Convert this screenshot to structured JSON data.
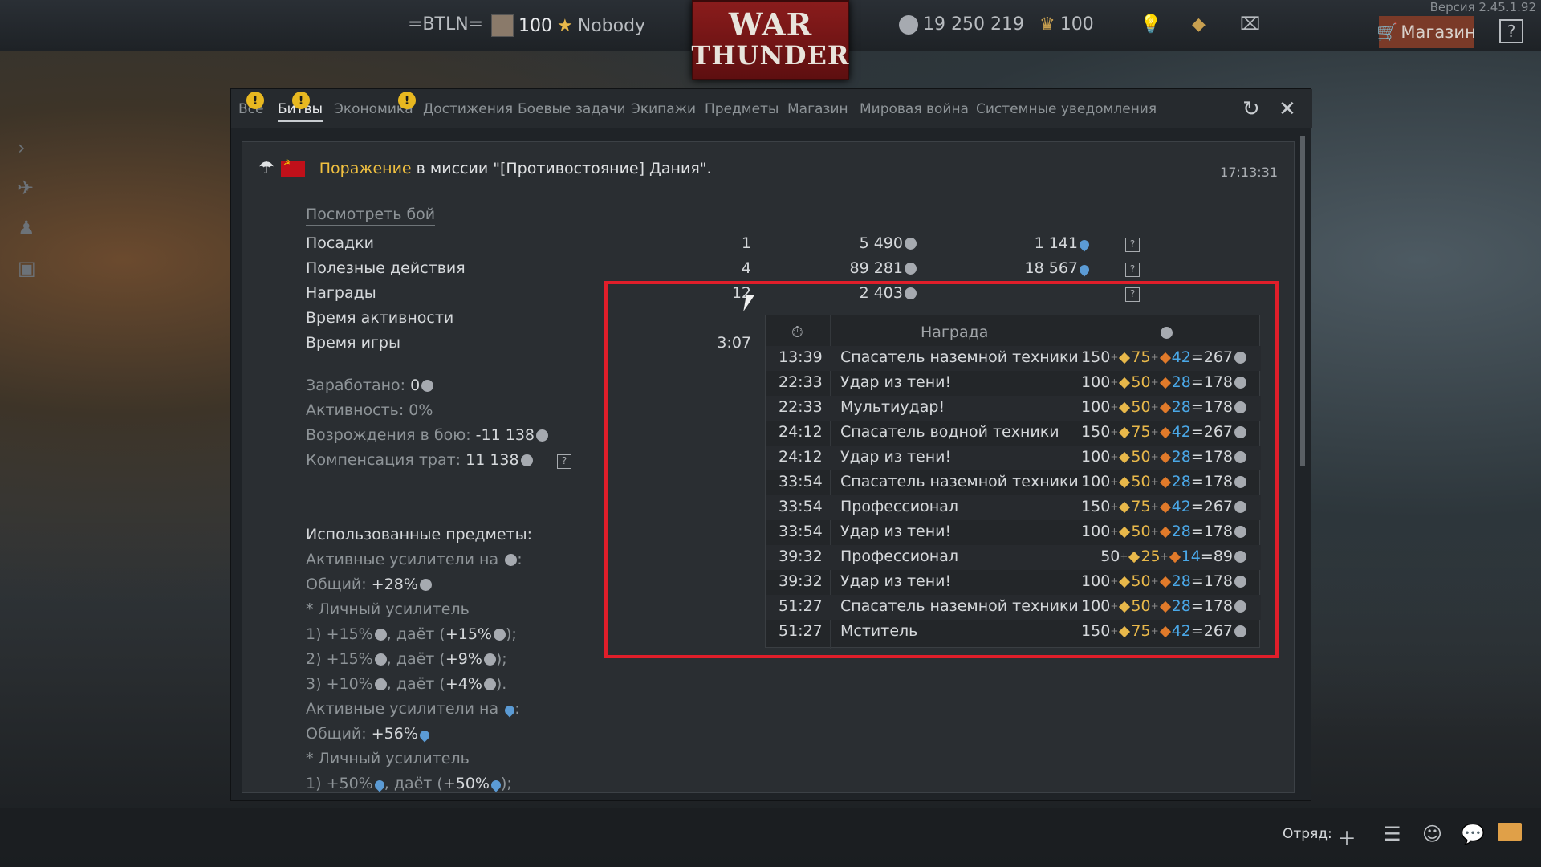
{
  "version": "Версия 2.45.1.92",
  "topbar": {
    "clan_tag": "=BTLN=",
    "level": "100",
    "nickname": "Nobody",
    "logo_line1": "WAR",
    "logo_line2": "THUNDER",
    "silver_lions": "19 250 219",
    "golden_eagles": "100",
    "shop_label": "Магазин",
    "help_label": "?"
  },
  "tabs": [
    {
      "label": "Все",
      "warn": true
    },
    {
      "label": "Битвы",
      "warn": true,
      "active": true
    },
    {
      "label": "Экономика",
      "warn": true
    },
    {
      "label": "Достижения"
    },
    {
      "label": "Боевые задачи"
    },
    {
      "label": "Экипажи"
    },
    {
      "label": "Предметы"
    },
    {
      "label": "Магазин"
    },
    {
      "label": "Мировая война"
    },
    {
      "label": "Системные уведомления"
    }
  ],
  "message": {
    "result": "Поражение",
    "text": "в миссии \"[Противостояние] Дания\".",
    "time": "17:13:31",
    "view_battle": "Посмотреть бой"
  },
  "stats": [
    {
      "label": "Посадки",
      "count": "1",
      "sl": "5 490",
      "rp": "1 141"
    },
    {
      "label": "Полезные действия",
      "count": "4",
      "sl": "89 281",
      "rp": "18 567"
    },
    {
      "label": "Награды",
      "count": "12",
      "sl": "2 403",
      "rp": ""
    },
    {
      "label": "Время активности",
      "count": "",
      "sl": "",
      "rp": ""
    },
    {
      "label": "Время игры",
      "count": "3:07",
      "sl": "",
      "rp": ""
    }
  ],
  "summary": {
    "earned_label": "Заработано:",
    "earned_value": "0",
    "activity": "Активность: 0%",
    "respawns_label": "Возрождения в бою:",
    "respawns_value": "-11 138",
    "compensation_label": "Компенсация трат:",
    "compensation_value": "11 138"
  },
  "boosters": {
    "title": "Использованные предметы:",
    "sl_active": "Активные усилители на",
    "sl_total_label": "Общий:",
    "sl_total": "+28%",
    "personal": "* Личный усилитель",
    "sl_items": [
      {
        "n": "1)",
        "pct": "+15%",
        "gives": "+15%"
      },
      {
        "n": "2)",
        "pct": "+15%",
        "gives": "+9%"
      },
      {
        "n": "3)",
        "pct": "+10%",
        "gives": "+4%"
      }
    ],
    "gives_label": "даёт",
    "rp_active": "Активные усилители на",
    "rp_total_label": "Общий:",
    "rp_total": "+56%",
    "rp_personal": "* Личный усилитель",
    "rp_items": [
      {
        "n": "1)",
        "pct": "+50%",
        "gives": "+50%"
      }
    ]
  },
  "tooltip": {
    "header_reward": "Награда",
    "rows": [
      {
        "time": "13:39",
        "name": "Спасатель наземной техники",
        "base": "150",
        "b1": "75",
        "b2": "42",
        "total": "267"
      },
      {
        "time": "22:33",
        "name": "Удар из тени!",
        "base": "100",
        "b1": "50",
        "b2": "28",
        "total": "178"
      },
      {
        "time": "22:33",
        "name": "Мультиудар!",
        "base": "100",
        "b1": "50",
        "b2": "28",
        "total": "178"
      },
      {
        "time": "24:12",
        "name": "Спасатель водной техники",
        "base": "150",
        "b1": "75",
        "b2": "42",
        "total": "267"
      },
      {
        "time": "24:12",
        "name": "Удар из тени!",
        "base": "100",
        "b1": "50",
        "b2": "28",
        "total": "178"
      },
      {
        "time": "33:54",
        "name": "Спасатель наземной техники",
        "base": "100",
        "b1": "50",
        "b2": "28",
        "total": "178"
      },
      {
        "time": "33:54",
        "name": "Профессионал",
        "base": "150",
        "b1": "75",
        "b2": "42",
        "total": "267"
      },
      {
        "time": "33:54",
        "name": "Удар из тени!",
        "base": "100",
        "b1": "50",
        "b2": "28",
        "total": "178"
      },
      {
        "time": "39:32",
        "name": "Профессионал",
        "base": "50",
        "b1": "25",
        "b2": "14",
        "total": "89"
      },
      {
        "time": "39:32",
        "name": "Удар из тени!",
        "base": "100",
        "b1": "50",
        "b2": "28",
        "total": "178"
      },
      {
        "time": "51:27",
        "name": "Спасатель наземной техники",
        "base": "100",
        "b1": "50",
        "b2": "28",
        "total": "178"
      },
      {
        "time": "51:27",
        "name": "Мститель",
        "base": "150",
        "b1": "75",
        "b2": "42",
        "total": "267"
      }
    ]
  },
  "bottombar": {
    "squad_label": "Отряд:"
  }
}
